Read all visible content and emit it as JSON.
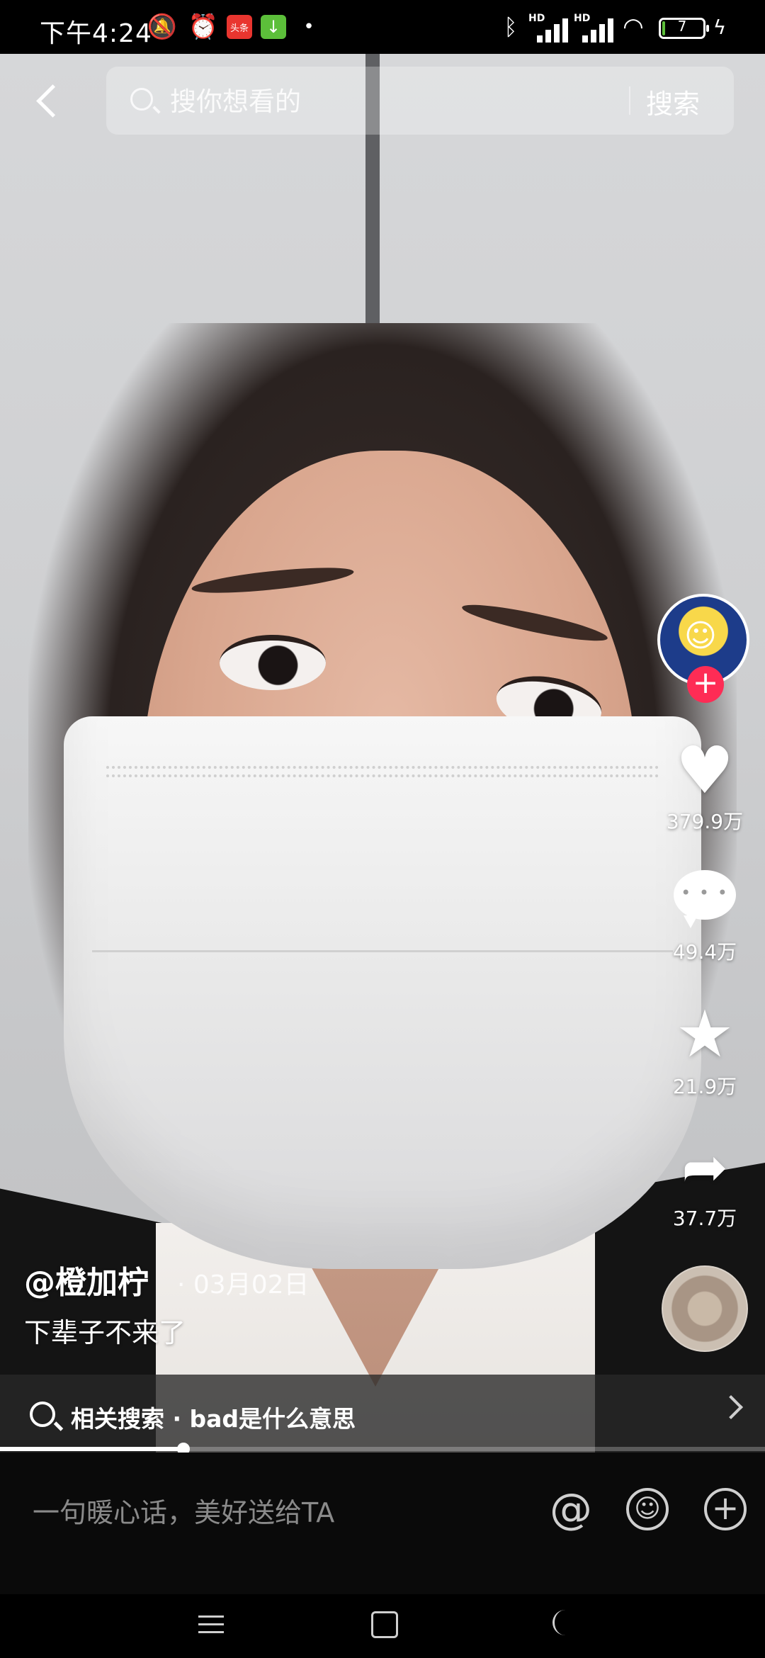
{
  "status_bar": {
    "time": "下午4:24",
    "toutiao_label": "头条",
    "signal1_label": "HD",
    "signal2_label": "HD",
    "battery_level": "7"
  },
  "header": {
    "search_placeholder": "搜你想看的",
    "search_button": "搜索"
  },
  "actions": {
    "like_count": "379.9万",
    "comment_count": "49.4万",
    "favorite_count": "21.9万",
    "share_count": "37.7万",
    "follow_symbol": "+"
  },
  "post": {
    "author": "@橙加柠",
    "date": "· 03月02日",
    "caption": "下辈子不来了"
  },
  "related_search": {
    "text": "相关搜索 · bad是什么意思"
  },
  "progress": {
    "fraction": 0.24
  },
  "comment_bar": {
    "placeholder": "一句暖心话，美好送给TA",
    "at_symbol": "@"
  },
  "icons": {
    "back": "back-icon",
    "search": "search-icon",
    "like": "heart-icon",
    "comment": "comment-icon",
    "favorite": "star-icon",
    "share": "share-icon",
    "emoji": "emoji-icon",
    "add": "plus-icon"
  },
  "colors": {
    "follow": "#fe2c55",
    "battery": "#5cbf3a"
  }
}
